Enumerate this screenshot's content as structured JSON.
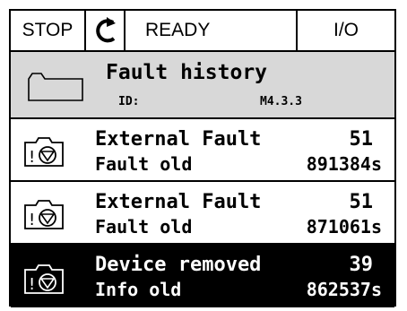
{
  "statusbar": {
    "stop_label": "STOP",
    "rotation_icon": "rotation-arrow-icon",
    "state_label": "READY",
    "control_label": "I/O"
  },
  "header": {
    "icon": "folder-icon",
    "title": "Fault history",
    "id_label": "ID:",
    "id_value": "M4.3.3",
    "background": "#d8d8d8"
  },
  "faults": [
    {
      "icon": "fault-camera-icon",
      "name": "External Fault",
      "code": "51",
      "type": "Fault old",
      "time": "891384s",
      "selected": false
    },
    {
      "icon": "fault-camera-icon",
      "name": "External Fault",
      "code": "51",
      "type": "Fault old",
      "time": "871061s",
      "selected": false
    },
    {
      "icon": "fault-camera-icon",
      "name": "Device removed",
      "code": "39",
      "type": "Info old",
      "time": "862537s",
      "selected": true
    }
  ],
  "colors": {
    "selected_bg": "#000000",
    "selected_fg": "#ffffff"
  }
}
